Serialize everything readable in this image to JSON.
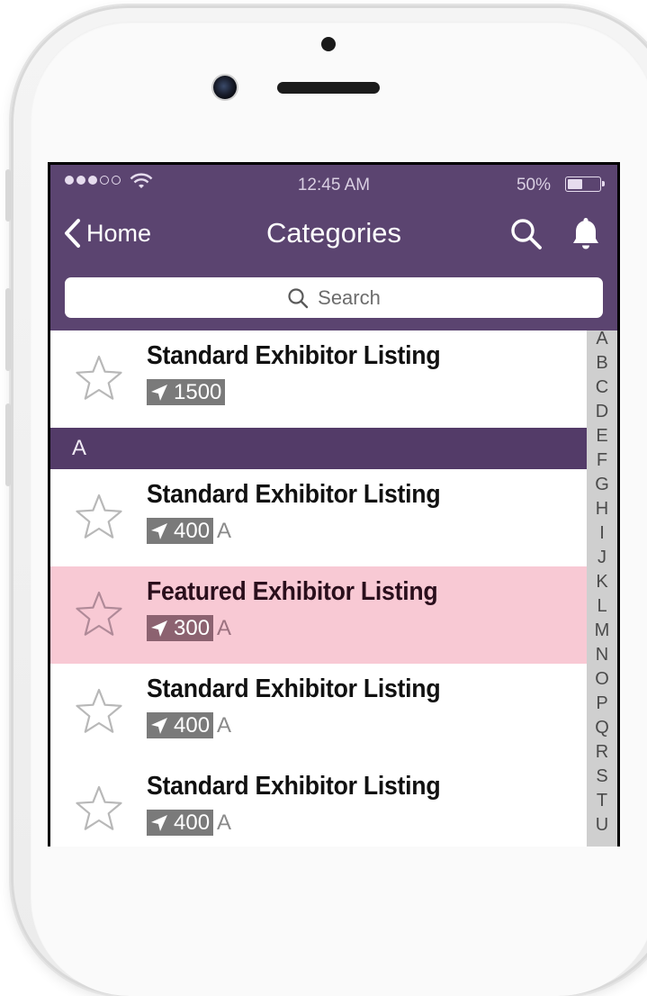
{
  "status_bar": {
    "time": "12:45 AM",
    "battery_pct": "50%",
    "signal_dots": 5,
    "signal_filled": 3
  },
  "nav": {
    "back_label": "Home",
    "title": "Categories"
  },
  "search": {
    "placeholder": "Search"
  },
  "list": {
    "top_item": {
      "title": "Standard Exhibitor Listing",
      "booth": "1500",
      "hall": "",
      "featured": false
    },
    "section_label": "A",
    "items": [
      {
        "title": "Standard Exhibitor Listing",
        "booth": "400",
        "hall": "A",
        "featured": false
      },
      {
        "title": "Featured Exhibitor Listing",
        "booth": "300",
        "hall": "A",
        "featured": true
      },
      {
        "title": "Standard Exhibitor Listing",
        "booth": "400",
        "hall": "A",
        "featured": false
      },
      {
        "title": "Standard Exhibitor Listing",
        "booth": "400",
        "hall": "A",
        "featured": false
      }
    ]
  },
  "index_letters": [
    "A",
    "B",
    "C",
    "D",
    "E",
    "F",
    "G",
    "H",
    "I",
    "J",
    "K",
    "L",
    "M",
    "N",
    "O",
    "P",
    "Q",
    "R",
    "S",
    "T",
    "U"
  ],
  "colors": {
    "header": "#5b4470",
    "section_header": "#533b68",
    "featured_row": "#f8c9d4"
  }
}
